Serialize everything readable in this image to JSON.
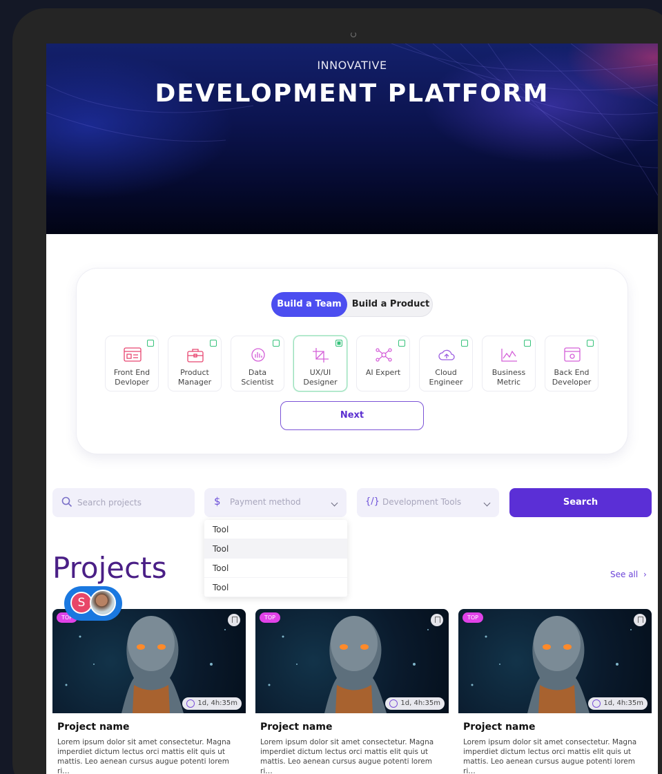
{
  "hero": {
    "kicker": "INNOVATIVE",
    "title": "DEVELOPMENT PLATFORM"
  },
  "builder": {
    "tabs": [
      {
        "label": "Build a Team",
        "active": true
      },
      {
        "label": "Build a Product",
        "active": false
      }
    ],
    "roles": [
      {
        "label": "Front End\nDevloper",
        "icon": "frontend-icon",
        "selected": false
      },
      {
        "label": "Product\nManager",
        "icon": "briefcase-icon",
        "selected": false
      },
      {
        "label": "Data\nScientist",
        "icon": "data-chart-icon",
        "selected": false
      },
      {
        "label": "UX/UI\nDesigner",
        "icon": "design-crop-icon",
        "selected": true
      },
      {
        "label": "AI Expert",
        "icon": "network-nodes-icon",
        "selected": false
      },
      {
        "label": "Cloud\nEngineer",
        "icon": "cloud-upload-icon",
        "selected": false
      },
      {
        "label": "Business\nMetric",
        "icon": "line-graph-icon",
        "selected": false
      },
      {
        "label": "Back End\nDeveloper",
        "icon": "server-window-icon",
        "selected": false
      }
    ],
    "next_label": "Next",
    "accent": "#4c4ef0",
    "check_color": "#35c27a"
  },
  "filters": {
    "search_placeholder": "Search projects",
    "payment": {
      "icon": "dollar-icon",
      "glyph": "$",
      "label": "Payment method"
    },
    "tools": {
      "icon": "code-icon",
      "glyph": "{/}",
      "label": "Development Tools"
    },
    "search_button": "Search",
    "menu_items": [
      "Tool",
      "Tool",
      "Tool",
      "Tool"
    ],
    "button_color": "#5b2fd6"
  },
  "projects": {
    "title": "Projects",
    "see_all": "See all",
    "see_all_glyph": "›",
    "avatar_initial": "S",
    "items": [
      {
        "badge": "TOP",
        "timer": "1d, 4h:35m",
        "name": "Project name",
        "desc": "Lorem ipsum dolor sit amet consectetur. Magna imperdiet dictum lectus orci mattis elit quis ut mattis. Leo aenean cursus augue potenti lorem ri…"
      },
      {
        "badge": "TOP",
        "timer": "1d, 4h:35m",
        "name": "Project name",
        "desc": "Lorem ipsum dolor sit amet consectetur. Magna imperdiet dictum lectus orci mattis elit quis ut mattis. Leo aenean cursus augue potenti lorem ri…"
      },
      {
        "badge": "TOP",
        "timer": "1d, 4h:35m",
        "name": "Project name",
        "desc": "Lorem ipsum dolor sit amet consectetur. Magna imperdiet dictum lectus orci mattis elit quis ut mattis. Leo aenean cursus augue potenti lorem ri…"
      }
    ]
  }
}
